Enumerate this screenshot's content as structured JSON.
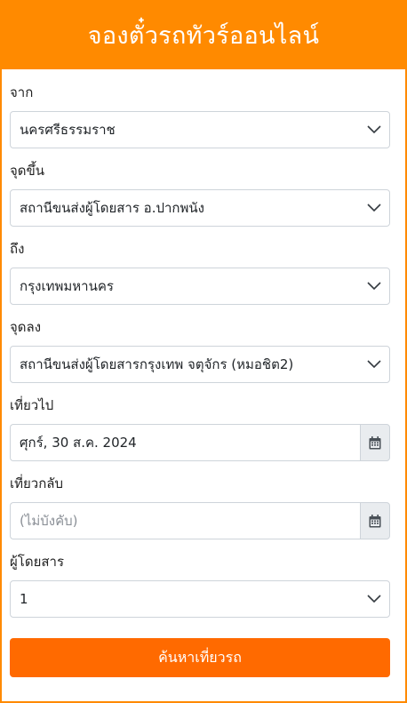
{
  "header": {
    "title": "จองตั๋วรถทัวร์ออนไลน์"
  },
  "form": {
    "from": {
      "label": "จาก",
      "value": "นครศรีธรรมราช"
    },
    "pickup": {
      "label": "จุดขึ้น",
      "value": "สถานีขนส่งผู้โดยสาร อ.ปากพนัง"
    },
    "to": {
      "label": "ถึง",
      "value": "กรุงเทพมหานคร"
    },
    "dropoff": {
      "label": "จุดลง",
      "value": "สถานีขนส่งผู้โดยสารกรุงเทพ จตุจักร (หมอชิต2)"
    },
    "depart": {
      "label": "เที่ยวไป",
      "value": "ศุกร์, 30 ส.ค. 2024"
    },
    "return": {
      "label": "เที่ยวกลับ",
      "placeholder": "(ไม่บังคับ)"
    },
    "passengers": {
      "label": "ผู้โดยสาร",
      "value": "1"
    },
    "submit_label": "ค้นหาเที่ยวรถ"
  },
  "icons": {
    "dropdown": "chevron-down-icon",
    "calendar": "calendar-icon"
  },
  "colors": {
    "header_bg": "#ff8a00",
    "button_bg": "#ff6a00",
    "calendar_btn_bg": "#e9ecef"
  }
}
